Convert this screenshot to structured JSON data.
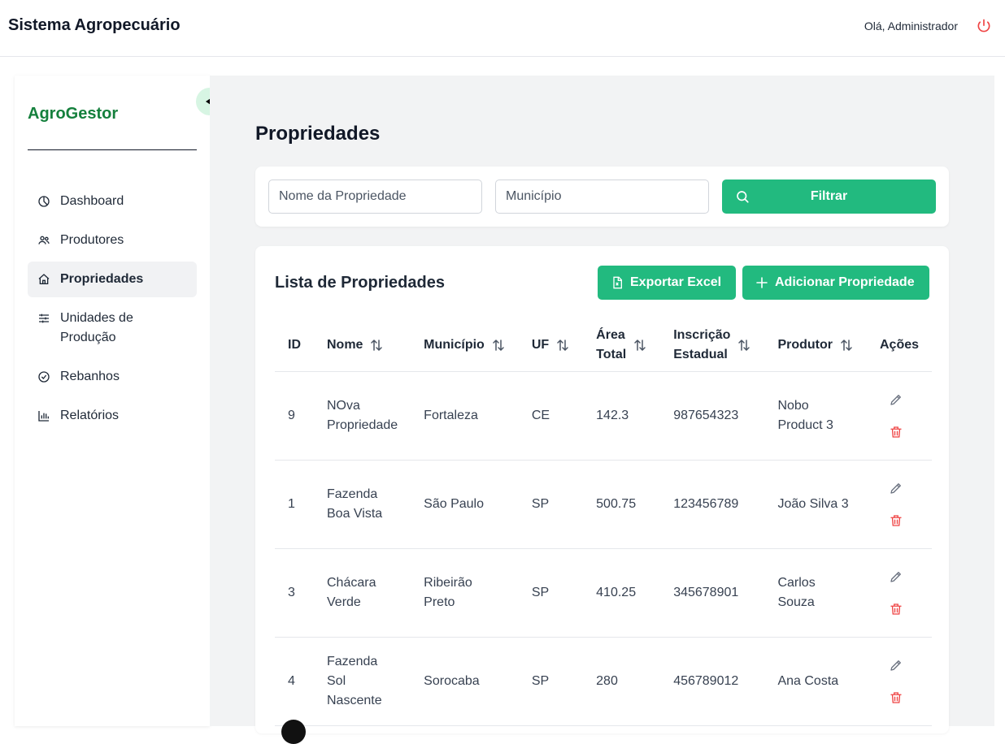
{
  "header": {
    "title": "Sistema Agropecuário",
    "greeting": "Olá, Administrador"
  },
  "sidebar": {
    "brand": "AgroGestor",
    "items": [
      {
        "label": "Dashboard",
        "icon": "dashboard-icon"
      },
      {
        "label": "Produtores",
        "icon": "users-icon"
      },
      {
        "label": "Propriedades",
        "icon": "home-icon",
        "active": true
      },
      {
        "label": "Unidades de Produção",
        "icon": "sliders-icon"
      },
      {
        "label": "Rebanhos",
        "icon": "check-circle-icon"
      },
      {
        "label": "Relatórios",
        "icon": "bar-chart-icon"
      }
    ]
  },
  "page": {
    "title": "Propriedades"
  },
  "filters": {
    "name_placeholder": "Nome da Propriedade",
    "municipio_placeholder": "Município",
    "filter_label": "Filtrar"
  },
  "list": {
    "title": "Lista de Propriedades",
    "export_label": "Exportar Excel",
    "add_label": "Adicionar Propriedade",
    "columns": [
      "ID",
      "Nome",
      "Município",
      "UF",
      "Área Total",
      "Inscrição Estadual",
      "Produtor",
      "Ações"
    ],
    "rows": [
      {
        "id": "9",
        "nome": "NOva Propriedade",
        "municipio": "Fortaleza",
        "uf": "CE",
        "area": "142.3",
        "inscricao": "987654323",
        "produtor": "Nobo Product 3"
      },
      {
        "id": "1",
        "nome": "Fazenda Boa Vista",
        "municipio": "São Paulo",
        "uf": "SP",
        "area": "500.75",
        "inscricao": "123456789",
        "produtor": "João Silva 3"
      },
      {
        "id": "3",
        "nome": "Chácara Verde",
        "municipio": "Ribeirão Preto",
        "uf": "SP",
        "area": "410.25",
        "inscricao": "345678901",
        "produtor": "Carlos Souza"
      },
      {
        "id": "4",
        "nome": "Fazenda Sol Nascente",
        "municipio": "Sorocaba",
        "uf": "SP",
        "area": "280",
        "inscricao": "456789012",
        "produtor": "Ana Costa"
      }
    ]
  },
  "colors": {
    "primary": "#22ba7f",
    "brand": "#15803d",
    "danger": "#ef4444"
  }
}
